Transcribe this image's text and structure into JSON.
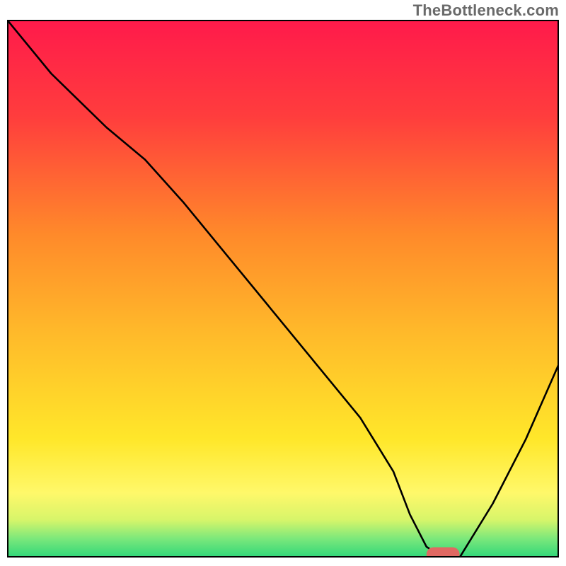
{
  "watermark": "TheBottleneck.com",
  "chart_data": {
    "type": "line",
    "title": "",
    "xlabel": "",
    "ylabel": "",
    "xlim": [
      0,
      100
    ],
    "ylim": [
      0,
      100
    ],
    "grid": false,
    "axes_visible": false,
    "background_gradient_stops": [
      {
        "offset": 0.0,
        "color": "#ff1a4b"
      },
      {
        "offset": 0.18,
        "color": "#ff3d3d"
      },
      {
        "offset": 0.4,
        "color": "#ff8a2a"
      },
      {
        "offset": 0.58,
        "color": "#ffb92a"
      },
      {
        "offset": 0.78,
        "color": "#ffe72a"
      },
      {
        "offset": 0.88,
        "color": "#fff86a"
      },
      {
        "offset": 0.93,
        "color": "#d7f56a"
      },
      {
        "offset": 0.965,
        "color": "#7be87b"
      },
      {
        "offset": 1.0,
        "color": "#2fd67a"
      }
    ],
    "series": [
      {
        "name": "bottleneck-curve",
        "stroke": "#000000",
        "stroke_width": 2.6,
        "x": [
          0,
          8,
          18,
          25,
          32,
          40,
          48,
          56,
          64,
          70,
          73,
          76,
          79,
          82,
          88,
          94,
          100
        ],
        "y": [
          100,
          90,
          80,
          74,
          66,
          56,
          46,
          36,
          26,
          16,
          8,
          2,
          0,
          0,
          10,
          22,
          36
        ]
      }
    ],
    "marker": {
      "name": "optimal-marker",
      "shape": "rounded-bar",
      "color": "#e06862",
      "x_start": 76,
      "x_end": 82,
      "y": 0.6,
      "height": 2.6
    },
    "frame": {
      "stroke": "#000000",
      "stroke_width": 4
    }
  }
}
